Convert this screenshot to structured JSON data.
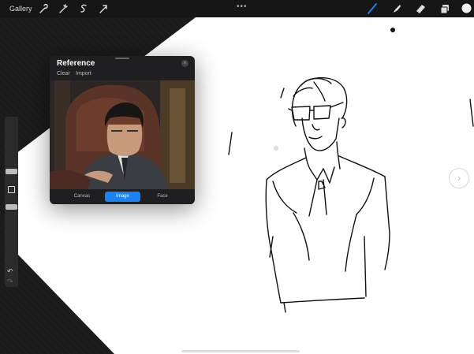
{
  "topbar": {
    "gallery_label": "Gallery",
    "left_tools": [
      "wrench-icon",
      "adjustments-icon",
      "selection-icon",
      "transform-icon"
    ],
    "right_tools": [
      "brush-icon",
      "smudge-icon",
      "eraser-icon",
      "layers-icon",
      "color-swatch"
    ],
    "accent_color": "#1a82f5",
    "current_color": "#f0f0f0"
  },
  "reference": {
    "title": "Reference",
    "clear_label": "Clear",
    "import_label": "Import",
    "tabs": [
      "Canvas",
      "Image",
      "Face"
    ],
    "active_tab": "Image"
  },
  "sidebar": {
    "brush_size_level": 0.15,
    "opacity_level": 0.55,
    "modify_label": "",
    "undo_icon": "undo-icon",
    "redo_icon": "redo-icon"
  }
}
